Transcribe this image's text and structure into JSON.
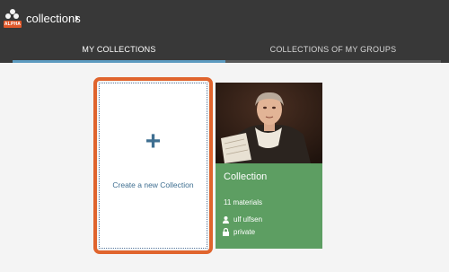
{
  "header": {
    "logo_badge": "ALPHA",
    "title": "collections",
    "chevron": "›"
  },
  "tabs": [
    {
      "label": "MY COLLECTIONS",
      "active": true
    },
    {
      "label": "COLLECTIONS OF MY GROUPS",
      "active": false
    }
  ],
  "new_collection": {
    "plus": "+",
    "label": "Create a new Collection"
  },
  "collection": {
    "title": "Collection",
    "materials": "11 materials",
    "owner": "ulf ulfsen",
    "visibility": "private"
  },
  "colors": {
    "topbar": "#383838",
    "accent_orange": "#e0642d",
    "tab_underline": "#5d9bc0",
    "card_green": "#5d9e62",
    "link_blue": "#3f6f91"
  },
  "icons": {
    "logo": "people-cluster-logo-icon",
    "chevron": "chevron-right-icon",
    "plus": "plus-icon",
    "owner": "user-icon",
    "visibility": "lock-icon"
  }
}
